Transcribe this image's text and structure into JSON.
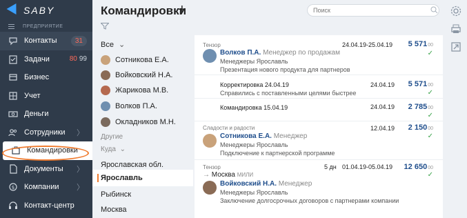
{
  "app": {
    "logo_text": "SABY",
    "section_label": "ПРЕДПРИЯТИЕ"
  },
  "sidebar": {
    "items": [
      {
        "label": "Контакты",
        "icon": "chat-bubble-icon",
        "badge": "31"
      },
      {
        "label": "Задачи",
        "icon": "tasks-icon",
        "badge_red": "80",
        "badge_gray": "99"
      },
      {
        "label": "Бизнес",
        "icon": "business-icon"
      },
      {
        "label": "Учет",
        "icon": "accounting-icon"
      },
      {
        "label": "Деньги",
        "icon": "money-icon"
      },
      {
        "label": "Сотрудники",
        "icon": "people-icon",
        "chevron": "〉"
      },
      {
        "label": "Командировки",
        "icon": "suitcase-icon"
      },
      {
        "label": "Документы",
        "icon": "documents-icon",
        "chevron": "〉"
      },
      {
        "label": "Компании",
        "icon": "company-icon",
        "chevron": "〉"
      },
      {
        "label": "Контакт-центр",
        "icon": "headset-icon"
      }
    ]
  },
  "header": {
    "title": "Командировки",
    "add_label": "+",
    "search_placeholder": "Поиск"
  },
  "filters": {
    "all_label": "Все",
    "people": [
      {
        "name": "Сотникова Е.А.",
        "color": "#c9a27a"
      },
      {
        "name": "Войковский Н.А.",
        "color": "#8a6b55"
      },
      {
        "name": "Жарикова М.В.",
        "color": "#b5694f"
      },
      {
        "name": "Волков П.А.",
        "color": "#6f8fb0"
      },
      {
        "name": "Окладников М.Н.",
        "color": "#7b6a5d"
      }
    ],
    "other_label": "Другие",
    "where_label": "Куда",
    "cities": [
      "Ярославская обл.",
      "Ярославль",
      "Рыбинск",
      "Москва"
    ],
    "selected_city_index": 1
  },
  "trips": [
    {
      "org": "Тензор",
      "name": "Волков П.А.",
      "position": "Менеджер по продажам",
      "dept": "Менеджеры Ярославль",
      "purpose": "Презентация нового продукта для партнеров",
      "dates": "24.04.19-25.04.19",
      "amount": "5 571",
      "kop": "00"
    },
    {
      "title": "Корректировка 24.04.19",
      "note": "Справились с поставленными целями быстрее",
      "dates": "24.04.19",
      "amount": "5 571",
      "kop": "00"
    },
    {
      "title": "Командировка 15.04.19",
      "dates": "24.04.19",
      "amount": "2 785",
      "kop": "00"
    },
    {
      "org": "Сладости и радости",
      "name": "Сотникова Е.А.",
      "position": "Менеджер",
      "dept": "Менеджеры Ярославль",
      "purpose": "Подключение к партнерской программе",
      "dates": "12.04.19",
      "amount": "2 150",
      "kop": "00"
    },
    {
      "org": "Тензор",
      "route_city": "Москва",
      "route_note": "МИЛИ",
      "name": "Войковский Н.А.",
      "position": "Менеджер",
      "dept": "Менеджеры Ярославль",
      "purpose": "Заключение долгосрочных договоров с партнерами компании",
      "days": "5 дн",
      "dates": "01.04.19-05.04.19",
      "amount": "12 650",
      "kop": "00"
    }
  ],
  "colors": {
    "sidebar_bg": "#2f3b4a",
    "accent": "#f07b2e",
    "link": "#1f4e8c",
    "check": "#3aa34a"
  }
}
